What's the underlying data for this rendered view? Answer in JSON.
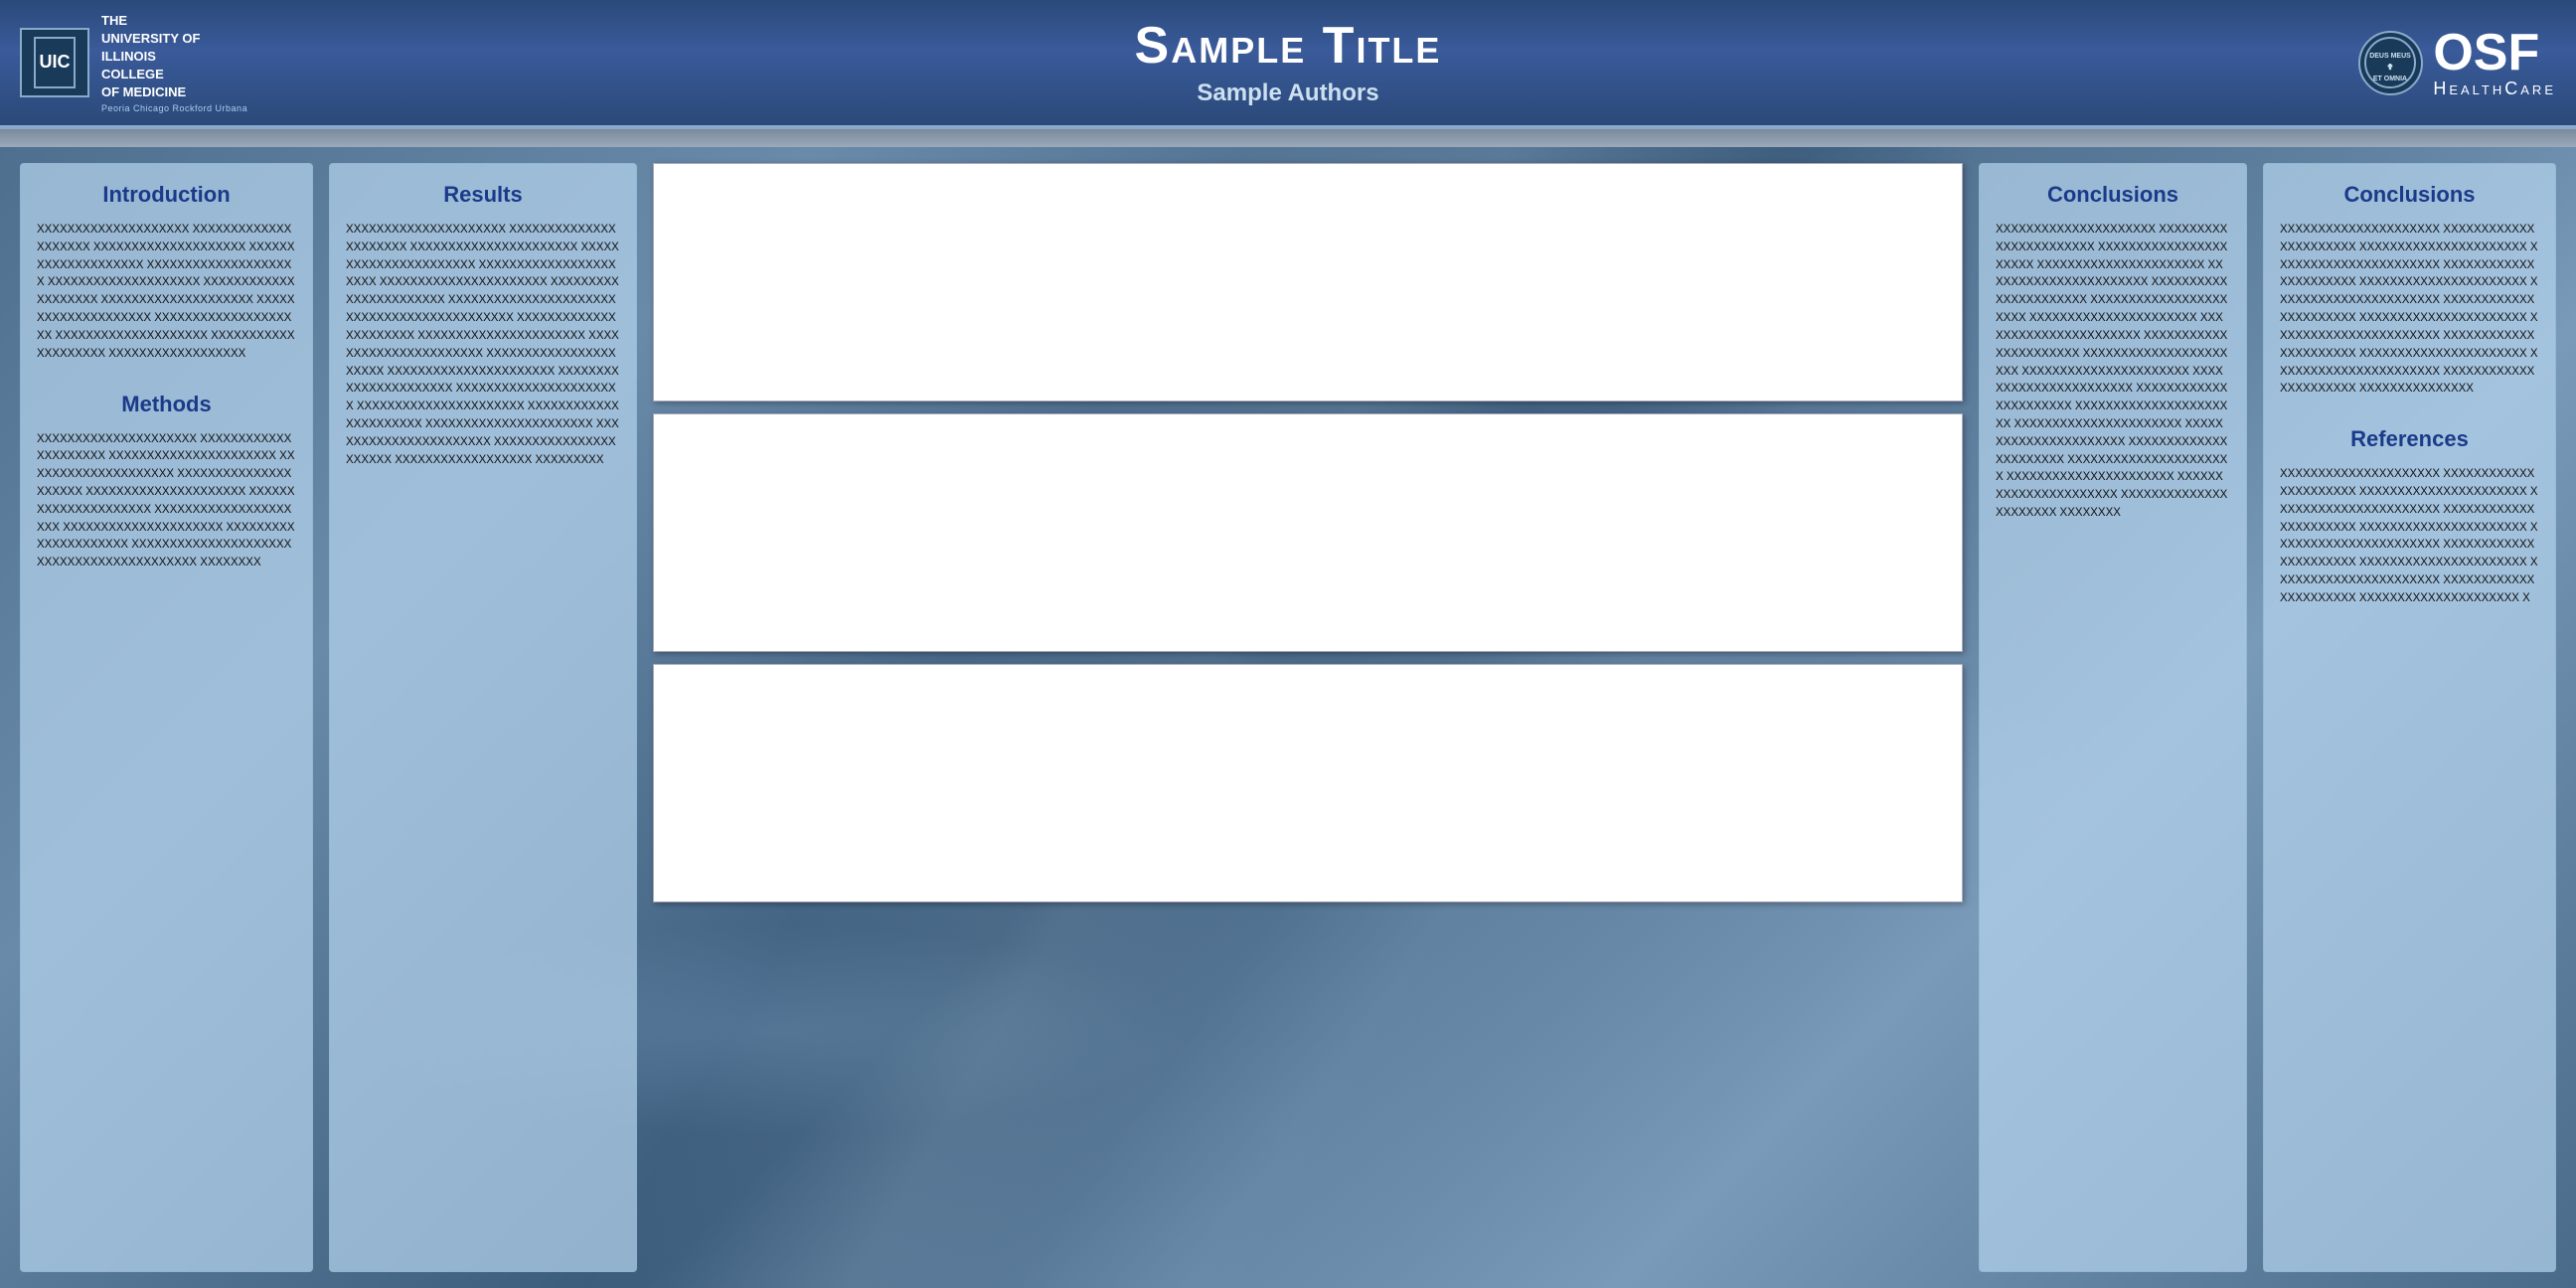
{
  "header": {
    "title": "Sample Title",
    "authors": "Sample Authors",
    "uic": {
      "name": "UIC",
      "line1": "The",
      "line2": "University of",
      "line3": "Illinois",
      "line4": "College",
      "line5": "of Medicine",
      "sub": "Peoria  Chicago  Rockford  Urbana"
    },
    "osf": {
      "label": "OSF",
      "sub": "HealthCare"
    }
  },
  "columns": {
    "col1": {
      "section1_title": "Introduction",
      "section1_text": "XXXXXXXXXXXXXXXXXXXX XXXXXXXXXXXXXXXXXXXX XXXXXXXXXXXXXXXXXXXX XXXXXXXXXXXXXXXXXXXX XXXXXXXXXXXXXXXXXXXX XXXXXXXXXXXXXXXXXXXX XXXXXXXXXXXXXXXXXXXX XXXXXXXXXXXXXXXXXXXX XXXXXXXXXXXXXXXXXXXX XXXXXXXXXXXXXXXXXXXX XXXXXXXXXXXXXXXXXXXX XXXXXXXXXXXXXXXXXXXX XXXXXXXXXXXXXXXXXX",
      "section2_title": "Methods",
      "section2_text": "XXXXXXXXXXXXXXXXXXXXX XXXXXXXXXXXXXXXXXXXXX XXXXXXXXXXXXXXXXXXXXXX XXXXXXXXXXXXXXXXXXXX XXXXXXXXXXXXXXXXXXXXX XXXXXXXXXXXXXXXXXXXXX XXXXXXXXXXXXXXXXXXXXX XXXXXXXXXXXXXXXXXXXXX XXXXXXXXXXXXXXXXXXXXX XXXXXXXXXXXXXXXXXXXXX XXXXXXXXXXXXXXXXXXXXX XXXXXXXXXXXXXXXXXXXXX XXXXXXXX"
    },
    "col2": {
      "section1_title": "Results",
      "section1_text": "XXXXXXXXXXXXXXXXXXXXX XXXXXXXXXXXXXXXXXXXXXX XXXXXXXXXXXXXXXXXXXXXX XXXXXXXXXXXXXXXXXXXXXX XXXXXXXXXXXXXXXXXXXXXX XXXXXXXXXXXXXXXXXXXXXX XXXXXXXXXXXXXXXXXXXXXX XXXXXXXXXXXXXXXXXXXXXX XXXXXXXXXXXXXXXXXXXXXX XXXXXXXXXXXXXXXXXXXXXX XXXXXXXXXXXXXXXXXXXXXX XXXXXXXXXXXXXXXXXXXXXX XXXXXXXXXXXXXXXXXXXXXX XXXXXXXXXXXXXXXXXXXXXX XXXXXXXXXXXXXXXXXXXXXX XXXXXXXXXXXXXXXXXXXXXX XXXXXXXXXXXXXXXXXXXXXX XXXXXXXXXXXXXXXXXXXXXX XXXXXXXXXXXXXXXXXXXXXX XXXXXXXXXXXXXXXXXXXXXX XXXXXXXXXXXXXXXXXXXXXX XXXXXXXXXXXXXXXXXX XXXXXXXXX"
    },
    "col3": {
      "section1_title": "Conclusions",
      "section1_text": "XXXXXXXXXXXXXXXXXXXXX XXXXXXXXXXXXXXXXXXXXXX XXXXXXXXXXXXXXXXXXXXXX XXXXXXXXXXXXXXXXXXXXXX XXXXXXXXXXXXXXXXXXXXXX XXXXXXXXXXXXXXXXXXXXXX XXXXXXXXXXXXXXXXXXXXXX XXXXXXXXXXXXXXXXXXXXXX XXXXXXXXXXXXXXXXXXXXXX XXXXXXXXXXXXXXXXXXXXXX XXXXXXXXXXXXXXXXXXXXXX XXXXXXXXXXXXXXXXXXXXXX XXXXXXXXXXXXXXXXXXXXXX XXXXXXXXXXXXXXXXXXXXXX XXXXXXXXXXXXXXXXXXXXXX XXXXXXXXXXXXXXXXXXXXXX XXXXXXXXXXXXXXXXXXXXXX XXXXXXXXXXXXXXXXXXXXXX XXXXXXXXXXXXXXXXXXXXXX XXXXXXXXXXXXXXXXXXXXXX XXXXXXXXXXXXXXXXXXXXXX XXXXXXXXXXXXXXXXXXXXXX XXXXXXXX"
    },
    "col4": {
      "section1_title": "Conclusions",
      "section1_text": "XXXXXXXXXXXXXXXXXXXXX XXXXXXXXXXXXXXXXXXXXXX XXXXXXXXXXXXXXXXXXXXXX XXXXXXXXXXXXXXXXXXXXXX XXXXXXXXXXXXXXXXXXXXXX XXXXXXXXXXXXXXXXXXXXXX XXXXXXXXXXXXXXXXXXXXXX XXXXXXXXXXXXXXXXXXXXXX XXXXXXXXXXXXXXXXXXXXXX XXXXXXXXXXXXXXXXXXXXXX XXXXXXXXXXXXXXXXXXXXXX XXXXXXXXXXXXXXXXXXXXXX XXXXXXXXXXXXXXXXXXXXXX XXXXXXXXXXXXXXXXXXXXXX XXXXXXXXXXXXXXX",
      "section2_title": "References",
      "section2_text": "XXXXXXXXXXXXXXXXXXXXX XXXXXXXXXXXXXXXXXXXXXX XXXXXXXXXXXXXXXXXXXXXX XXXXXXXXXXXXXXXXXXXXXX XXXXXXXXXXXXXXXXXXXXXX XXXXXXXXXXXXXXXXXXXXXX XXXXXXXXXXXXXXXXXXXXXX XXXXXXXXXXXXXXXXXXXXXX XXXXXXXXXXXXXXXXXXXXXX XXXXXXXXXXXXXXXXXXXXXX XXXXXXXXXXXXXXXXXXXXXX XXXXXXXXXXXXXXXXXXXXX X"
    }
  }
}
